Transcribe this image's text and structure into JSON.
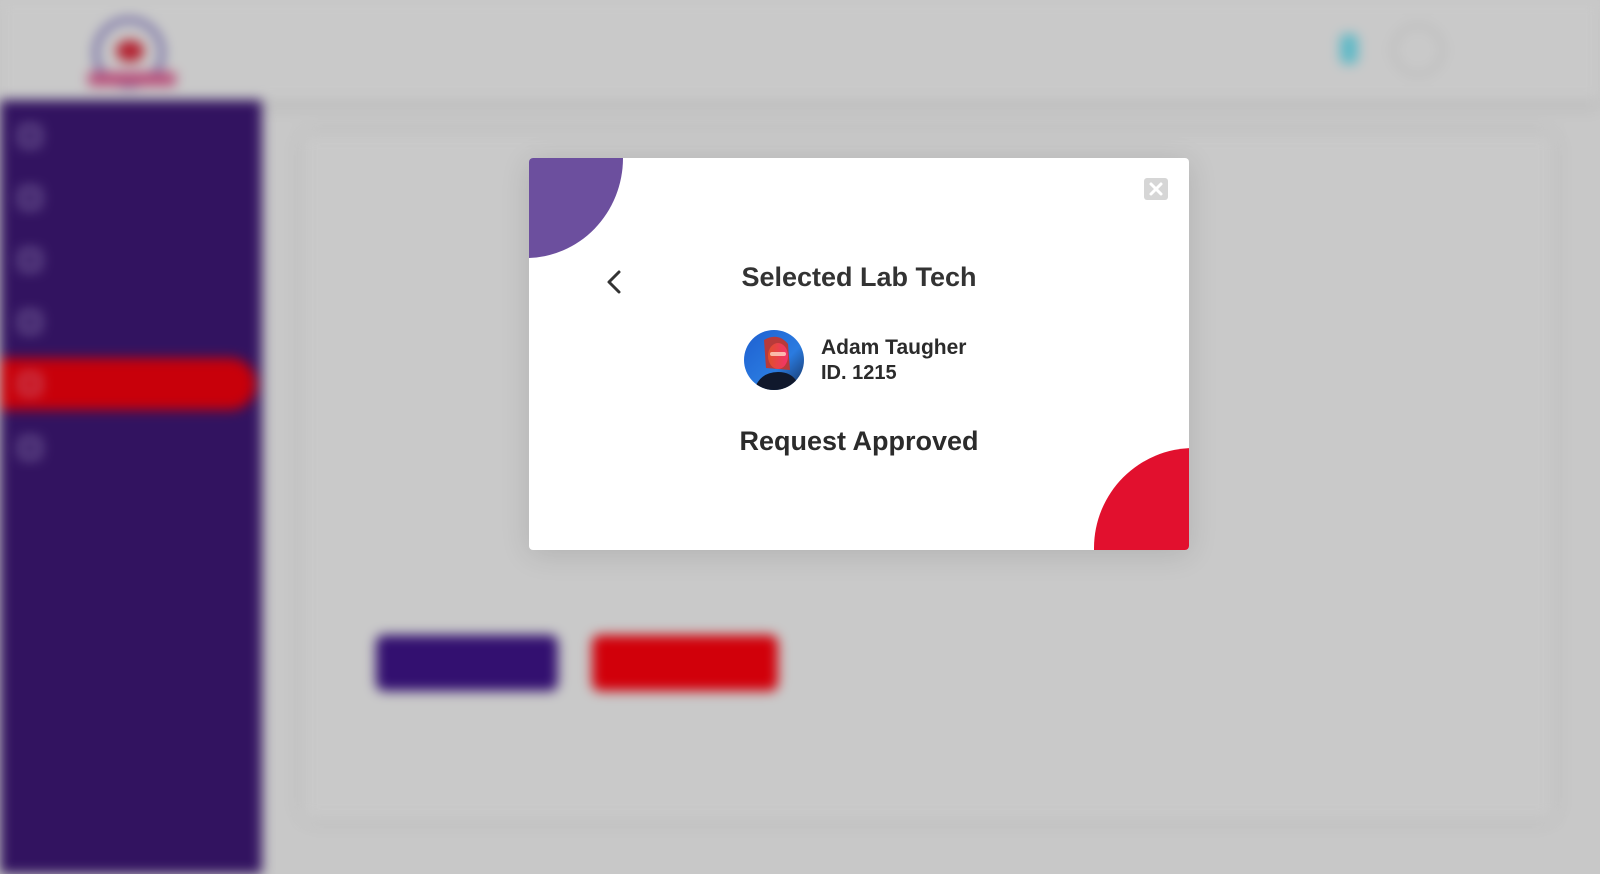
{
  "modal": {
    "title": "Selected Lab Tech",
    "tech": {
      "name": "Adam Taugher",
      "id": "ID. 1215"
    },
    "status": "Request Approved",
    "icons": {
      "back": "chevron-left-icon",
      "close": "close-icon"
    }
  },
  "colors": {
    "sidebar": "#321360",
    "active_item": "#c8000a",
    "modal_blob_purple": "#6c4f9e",
    "modal_blob_red": "#e2102e",
    "status_pending": "#e8a20a",
    "payment_status": "#27a3b8"
  }
}
